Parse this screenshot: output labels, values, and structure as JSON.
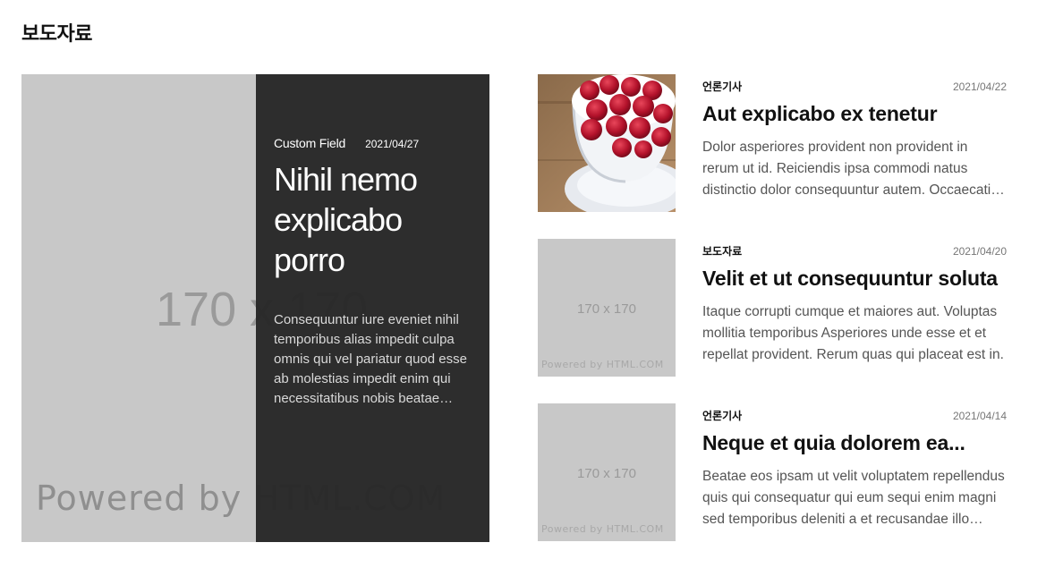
{
  "section": {
    "title": "보도자료"
  },
  "featured": {
    "image": {
      "size_label": "170 x 170",
      "powered_label": "Powered by HTML.COM"
    },
    "category": "Custom Field",
    "date": "2021/04/27",
    "title": "Nihil nemo explicabo porro",
    "excerpt": "Consequuntur iure eveniet nihil temporibus alias impedit culpa omnis qui vel pariatur quod esse ab molestias impedit enim qui necessitatibus nobis beatae voluptatem."
  },
  "posts": [
    {
      "category": "언론기사",
      "date": "2021/04/22",
      "title": "Aut explicabo ex tenetur",
      "excerpt": "Dolor asperiores provident non provident in rerum ut id. Reiciendis ipsa commodi natus distinctio dolor consequuntur autem. Occaecati voluptatem.",
      "image": {
        "kind": "raspberries-photo",
        "alt_icon": "raspberry-bowl-image"
      }
    },
    {
      "category": "보도자료",
      "date": "2021/04/20",
      "title": "Velit et ut consequuntur soluta",
      "excerpt": "Itaque corrupti cumque et maiores aut. Voluptas mollitia temporibus Asperiores unde esse et et repellat provident. Rerum quas qui placeat est in.",
      "image": {
        "kind": "placeholder",
        "size_label": "170 x 170",
        "powered_label": "Powered by HTML.COM"
      }
    },
    {
      "category": "언론기사",
      "date": "2021/04/14",
      "title": "Neque et quia dolorem ea...",
      "excerpt": "Beatae eos ipsam ut velit voluptatem repellendus quis qui consequatur qui eum sequi enim magni sed temporibus deleniti a et recusandae illo voluptas.",
      "image": {
        "kind": "placeholder",
        "size_label": "170 x 170",
        "powered_label": "Powered by HTML.COM"
      }
    }
  ],
  "colors": {
    "panel_bg": "#262626",
    "placeholder_bg": "#c8c8c8",
    "text": "#111111",
    "muted": "#555555"
  }
}
